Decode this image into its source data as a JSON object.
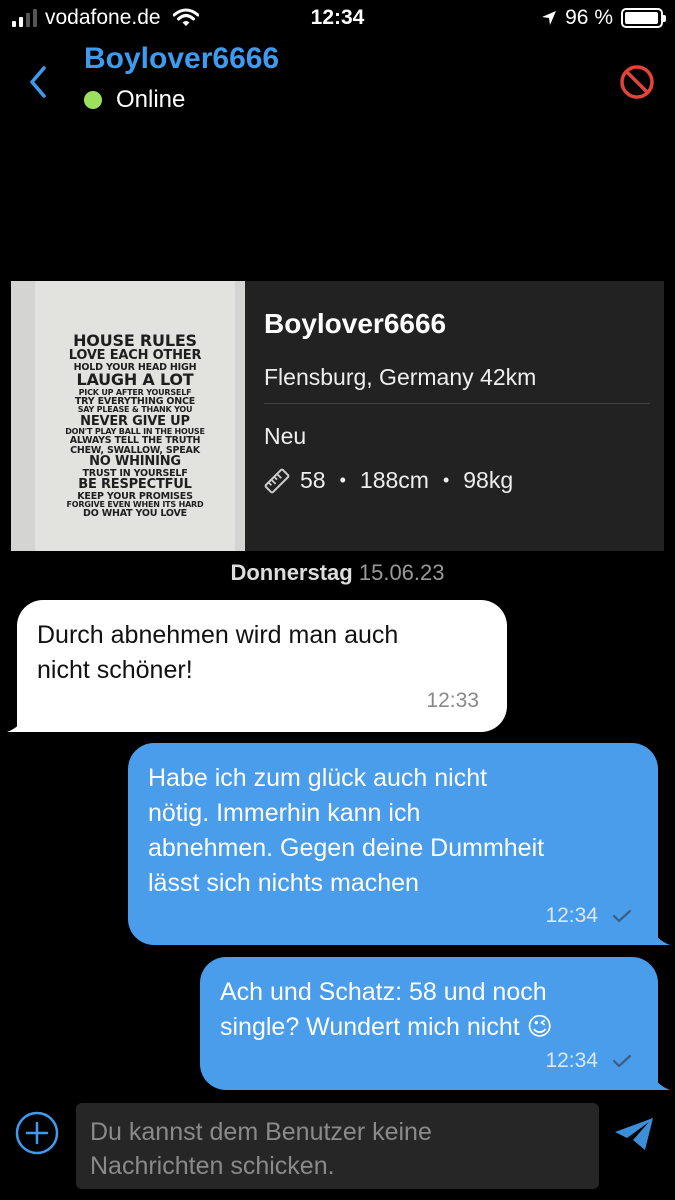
{
  "status_bar": {
    "carrier": "vodafone.de",
    "time": "12:34",
    "battery": "96 %",
    "battery_level": 0.96
  },
  "header": {
    "name": "Boylover6666",
    "status": "Online"
  },
  "profile": {
    "name": "Boylover6666",
    "location": "Flensburg, Germany 42km",
    "status": "Neu",
    "age": "58",
    "height": "188cm",
    "weight": "98kg",
    "photo_lines": [
      "HOUSE RULES",
      "LOVE EACH OTHER",
      "HOLD YOUR HEAD HIGH",
      "LAUGH A LOT",
      "PICK UP AFTER YOURSELF",
      "TRY EVERYTHING ONCE",
      "SAY PLEASE & THANK YOU",
      "NEVER GIVE UP",
      "DON'T PLAY BALL IN THE HOUSE",
      "ALWAYS TELL THE TRUTH",
      "CHEW, SWALLOW, SPEAK",
      "NO WHINING",
      "TRUST IN YOURSELF",
      "BE RESPECTFUL",
      "KEEP YOUR PROMISES",
      "FORGIVE EVEN WHEN ITS HARD",
      "DO WHAT YOU LOVE"
    ]
  },
  "date_separator": {
    "day": "Donnerstag",
    "date": "15.06.23"
  },
  "messages": [
    {
      "direction": "incoming",
      "lines": [
        "Durch abnehmen wird man auch",
        "nicht schöner!"
      ],
      "time": "12:33"
    },
    {
      "direction": "outgoing",
      "lines": [
        "Habe ich zum glück auch nicht",
        "nötig. Immerhin kann ich",
        "abnehmen. Gegen deine Dummheit",
        "lässt sich nichts machen"
      ],
      "time": "12:34"
    },
    {
      "direction": "outgoing",
      "lines": [
        "Ach und Schatz: 58 und noch",
        "single? Wundert mich nicht 😉"
      ],
      "time": "12:34"
    }
  ],
  "composer": {
    "lines": [
      "Du kannst dem Benutzer keine",
      "Nachrichten schicken."
    ]
  },
  "colors": {
    "accent": "#3d9cf0",
    "outgoing_bubble": "#4a9deb",
    "online": "#9be15d",
    "block": "#e0443a"
  }
}
